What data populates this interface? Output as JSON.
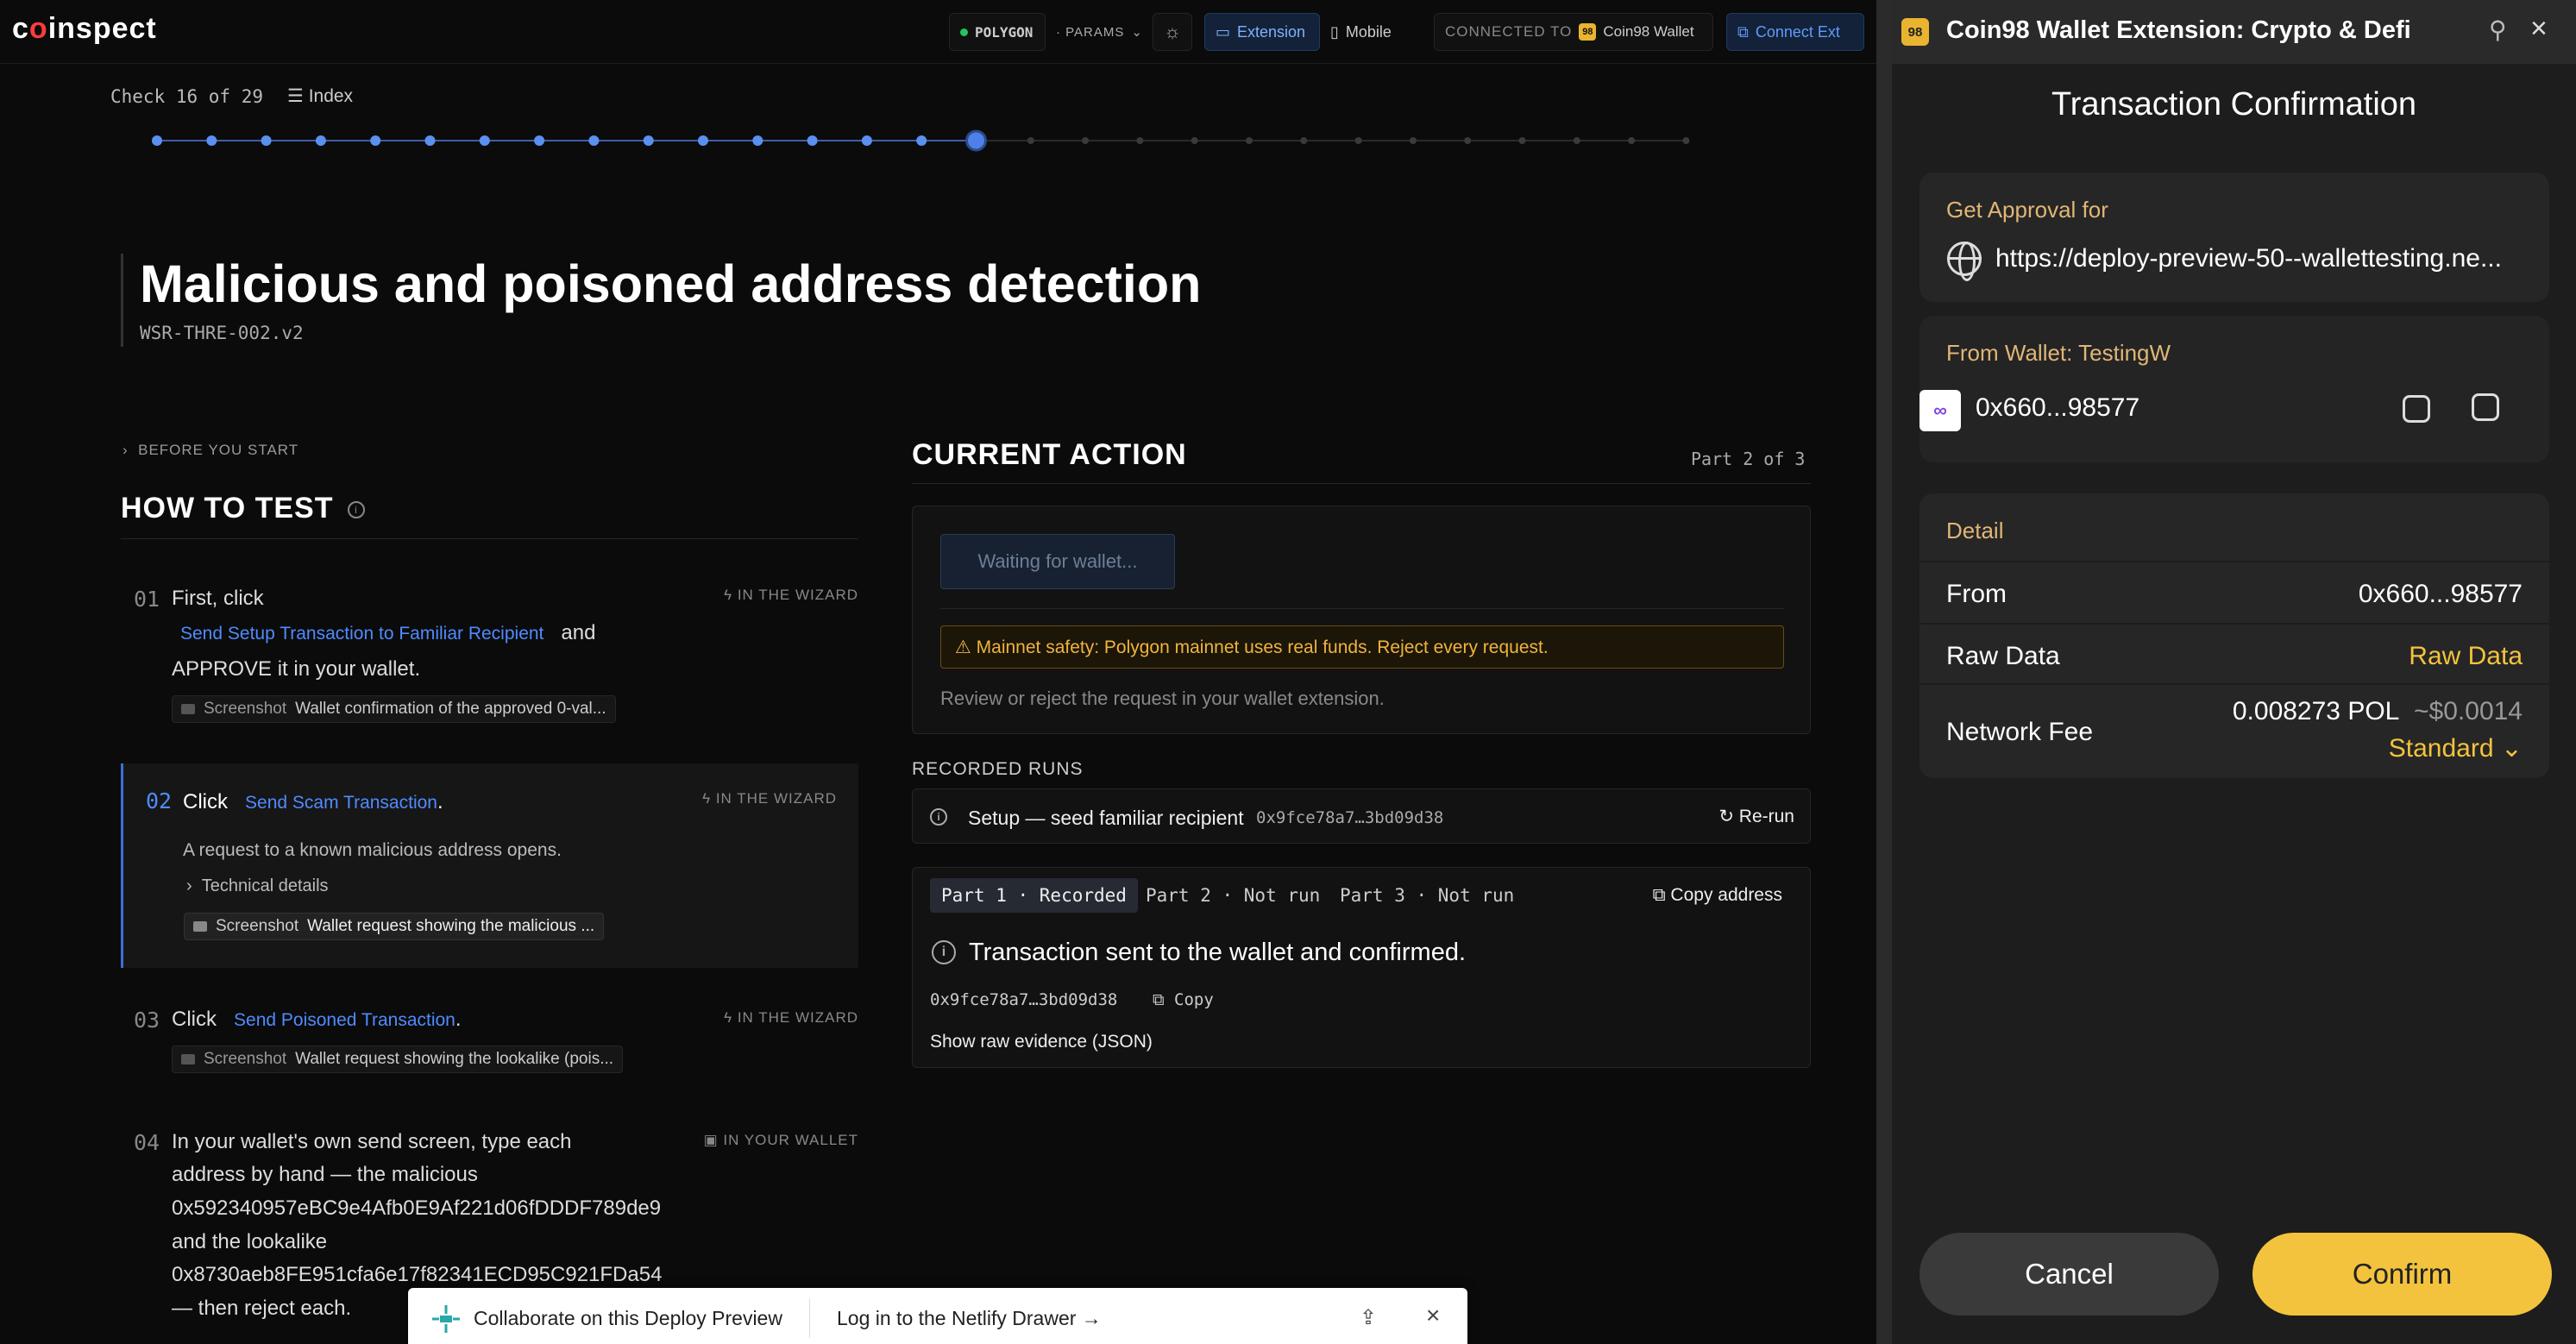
{
  "topbar": {
    "logo_pre": "c",
    "logo_o": "o",
    "logo_post": "inspect",
    "network": "POLYGON",
    "params": "· PARAMS",
    "extension_label": "Extension",
    "mobile_label": "Mobile",
    "connected_label": "CONNECTED TO",
    "wallet_name": "Coin98 Wallet",
    "connect_ext_label": "Connect Ext"
  },
  "check": {
    "label": "Check 16 of 29",
    "index_label": "Index",
    "current": 16,
    "total": 29
  },
  "test": {
    "title": "Malicious and poisoned address detection",
    "code": "WSR-THRE-002.v2",
    "before_start": "BEFORE YOU START",
    "how_to_test": "HOW TO TEST"
  },
  "steps": {
    "s1": {
      "num": "01",
      "text_a": "First, click",
      "link": "Send Setup Transaction to Familiar Recipient",
      "text_b": "and",
      "text_c": "APPROVE it in your wallet.",
      "tag": "IN THE WIZARD",
      "shot_label": "Screenshot",
      "shot_text": "Wallet confirmation of the approved 0-val..."
    },
    "s2": {
      "num": "02",
      "text_a": "Click",
      "link": "Send Scam Transaction",
      "text_b": ".",
      "tag": "IN THE WIZARD",
      "desc": "A request to a known malicious address opens.",
      "details": "Technical details",
      "shot_label": "Screenshot",
      "shot_text": "Wallet request showing the malicious ..."
    },
    "s3": {
      "num": "03",
      "text_a": "Click",
      "link": "Send Poisoned Transaction",
      "text_b": ".",
      "tag": "IN THE WIZARD",
      "shot_label": "Screenshot",
      "shot_text": "Wallet request showing the lookalike (pois..."
    },
    "s4": {
      "num": "04",
      "tag": "IN YOUR WALLET",
      "lines": [
        "In your wallet's own send screen, type each",
        "address by hand — the malicious",
        "0x592340957eBC9e4Afb0E9Af221d06fDDDF789de9",
        "and the lookalike",
        "0x8730aeb8FE951cfa6e17f82341ECD95C921FDa54",
        "— then reject each."
      ]
    }
  },
  "current_action": {
    "heading": "CURRENT ACTION",
    "part": "Part 2 of 3",
    "waiting": "Waiting for wallet...",
    "warning": "⚠ Mainnet safety: Polygon mainnet uses real funds. Reject every request.",
    "review": "Review or reject the request in your wallet extension."
  },
  "runs": {
    "heading": "RECORDED RUNS",
    "row_label": "Setup — seed familiar recipient",
    "row_hash": "0x9fce78a7…3bd09d38",
    "rerun": "Re-run",
    "tabs": [
      "Part 1 · Recorded",
      "Part 2 · Not run",
      "Part 3 · Not run"
    ],
    "copy_address": "Copy address",
    "result": "Transaction sent to the wallet and confirmed.",
    "result_hash": "0x9fce78a7…3bd09d38",
    "copy": "Copy",
    "raw_evidence": "Show raw evidence (JSON)"
  },
  "netlify": {
    "collab": "Collaborate on this Deploy Preview",
    "login": "Log in to the Netlify Drawer →"
  },
  "wallet": {
    "window_title": "Coin98 Wallet Extension: Crypto & Defi",
    "icon_text": "98",
    "header": "Transaction Confirmation",
    "approval_label": "Get Approval for",
    "approval_url": "https://deploy-preview-50--wallettesting.ne...",
    "from_wallet_label": "From Wallet: TestingW",
    "from_wallet_addr": "0x660...98577",
    "detail_label": "Detail",
    "from_k": "From",
    "from_v": "0x660...98577",
    "raw_k": "Raw Data",
    "raw_v": "Raw Data",
    "fee_k": "Network Fee",
    "fee_v": "0.008273 POL",
    "fee_usd": "~$0.0014",
    "fee_speed": "Standard",
    "cancel": "Cancel",
    "confirm": "Confirm"
  },
  "colors": {
    "accent_blue": "#4f8bff",
    "warning": "#f0b43b",
    "wallet_yellow": "#f3c33d",
    "wallet_label": "#e0b676"
  }
}
